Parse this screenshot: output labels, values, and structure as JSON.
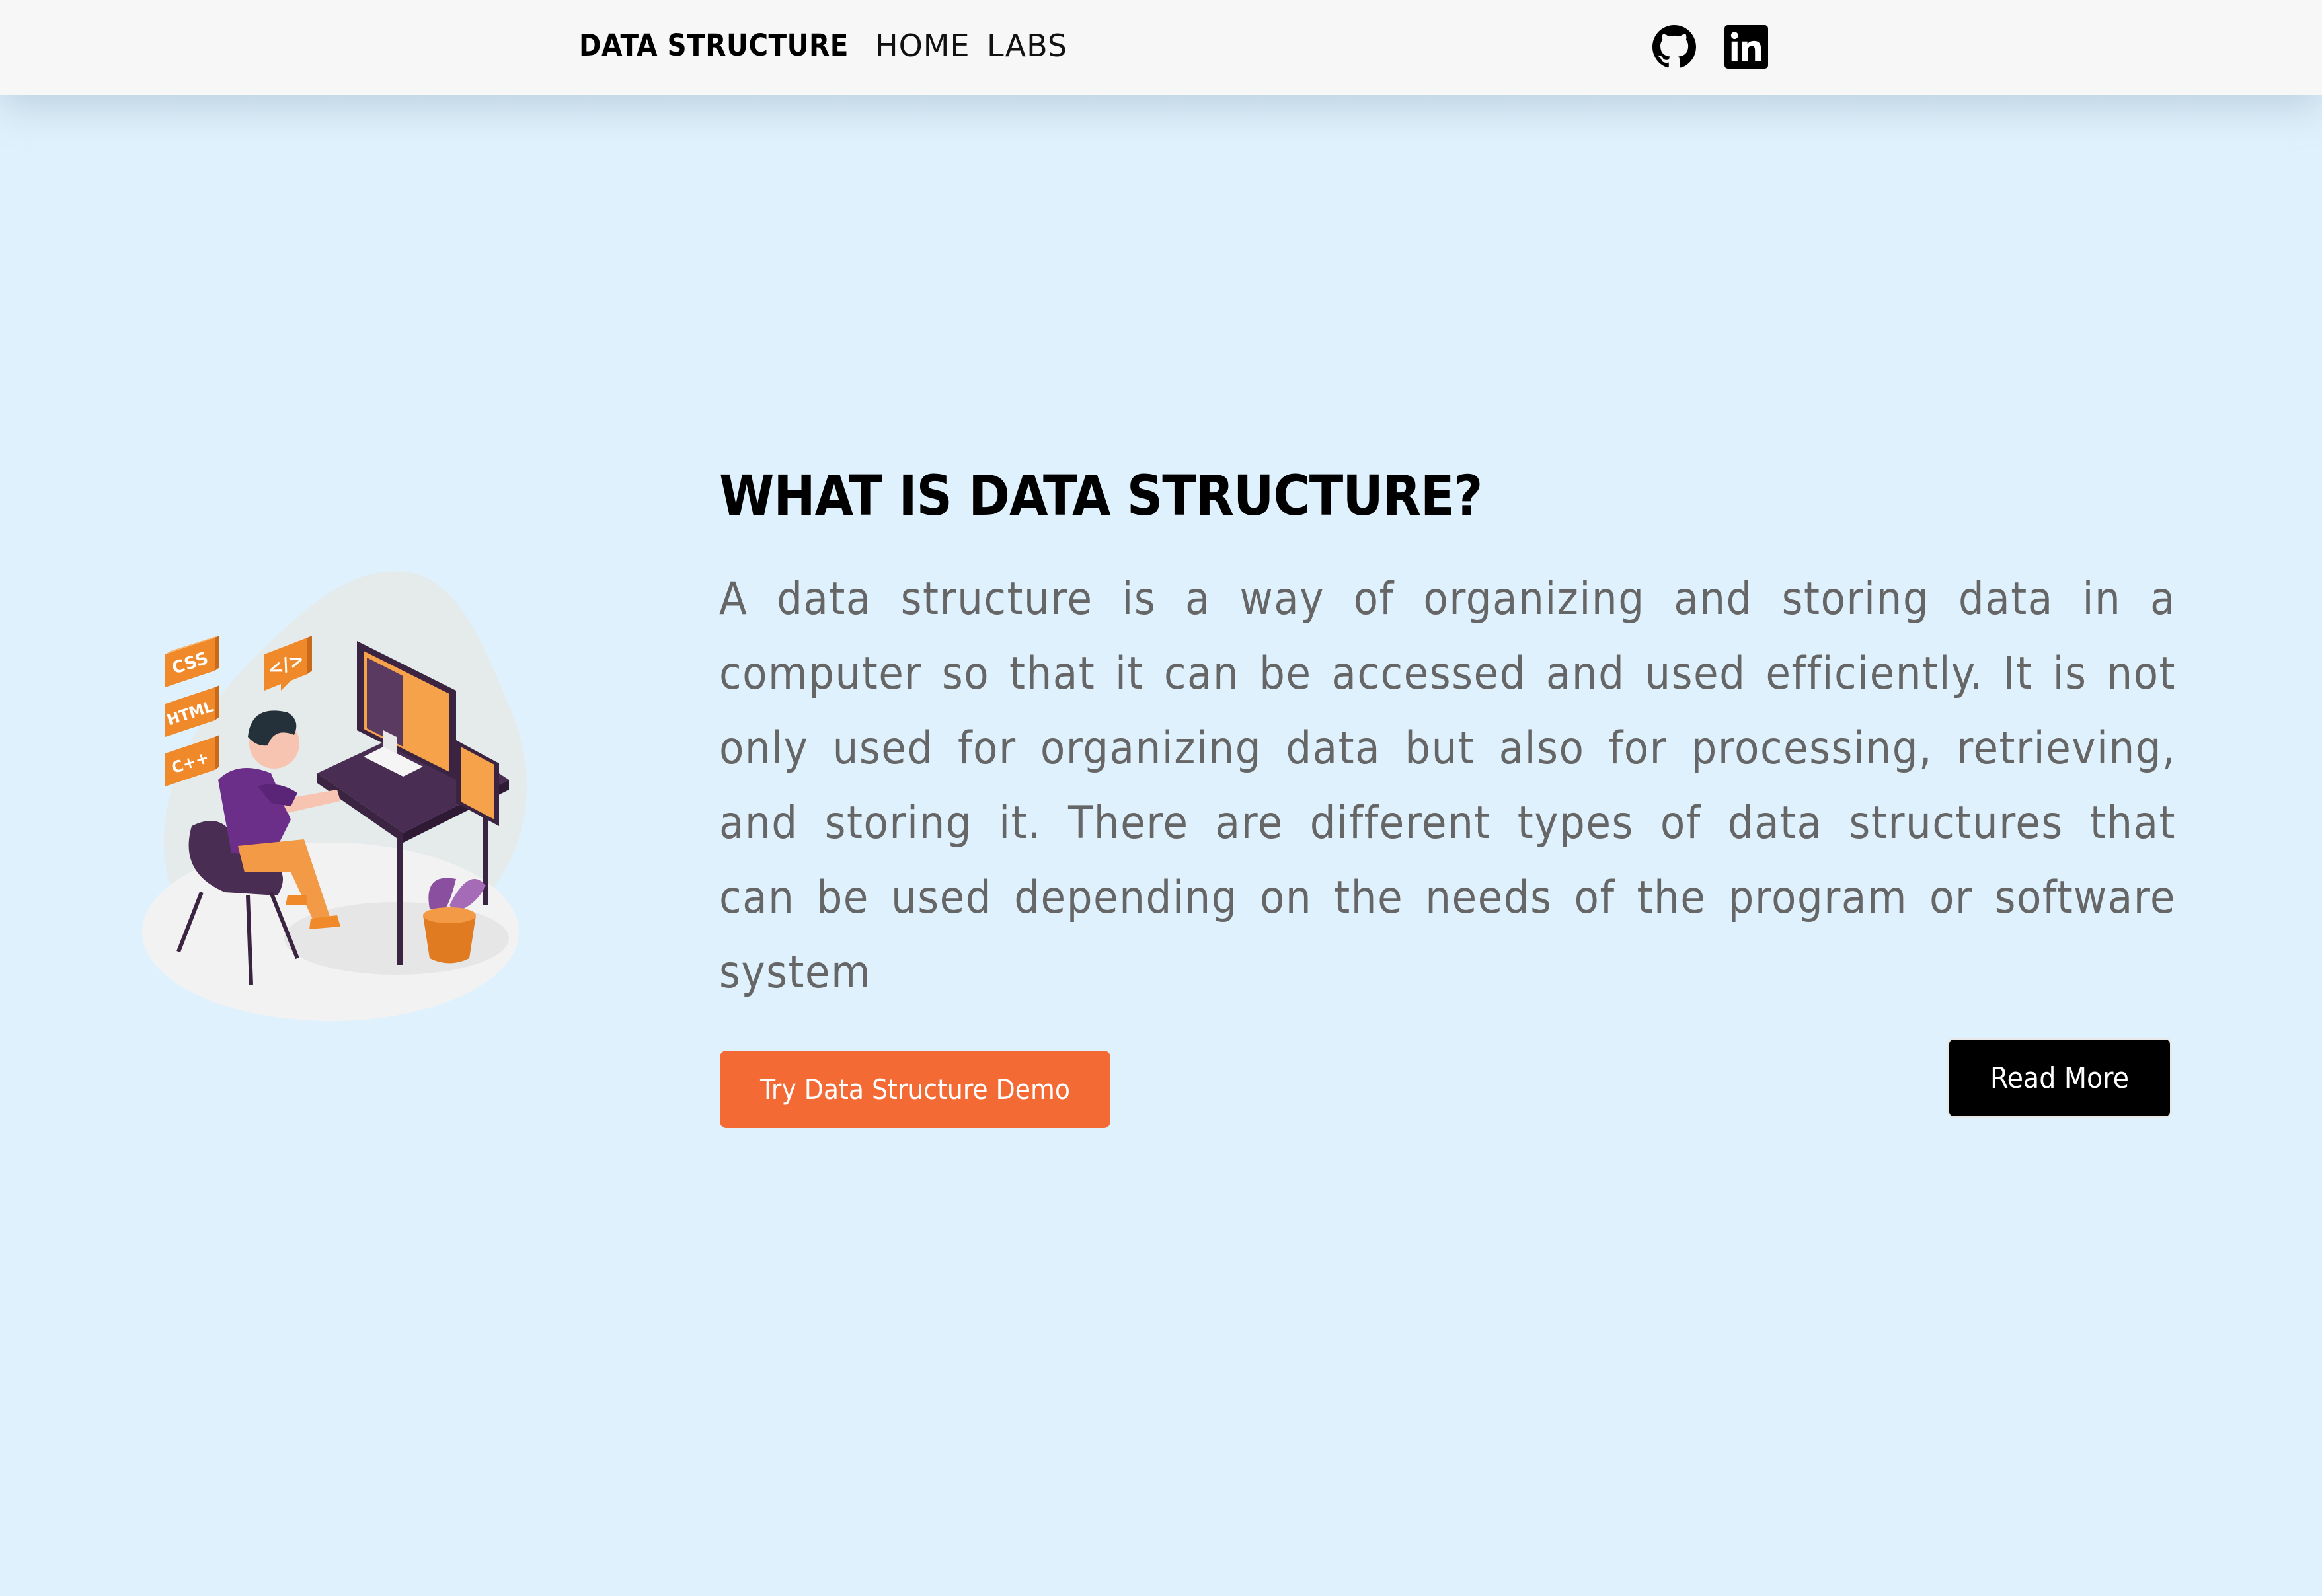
{
  "navbar": {
    "brand": "DATA STRUCTURE",
    "links": [
      "HOME",
      "LABS"
    ],
    "social_icons": [
      "github-icon",
      "linkedin-icon"
    ]
  },
  "hero": {
    "title": "WHAT IS DATA STRUCTURE?",
    "description": "A data structure is a way of organizing and storing data in a computer so that it can be accessed and used efficiently. It is not only used for organizing data but also for processing, retrieving, and storing it. There are different types of data structures that can be used depending on the needs of the program or software system",
    "illustration_tags": [
      "CSS",
      "HTML",
      "C++"
    ],
    "illustration_code_icon": "</>",
    "demo_button": "Try Data Structure Demo",
    "read_more_button": "Read More"
  },
  "colors": {
    "page_background": "#dff1fc",
    "navbar_background": "#f7f7f7",
    "accent_orange": "#f46a34",
    "read_more_background": "#000000",
    "body_text": "#666666"
  }
}
